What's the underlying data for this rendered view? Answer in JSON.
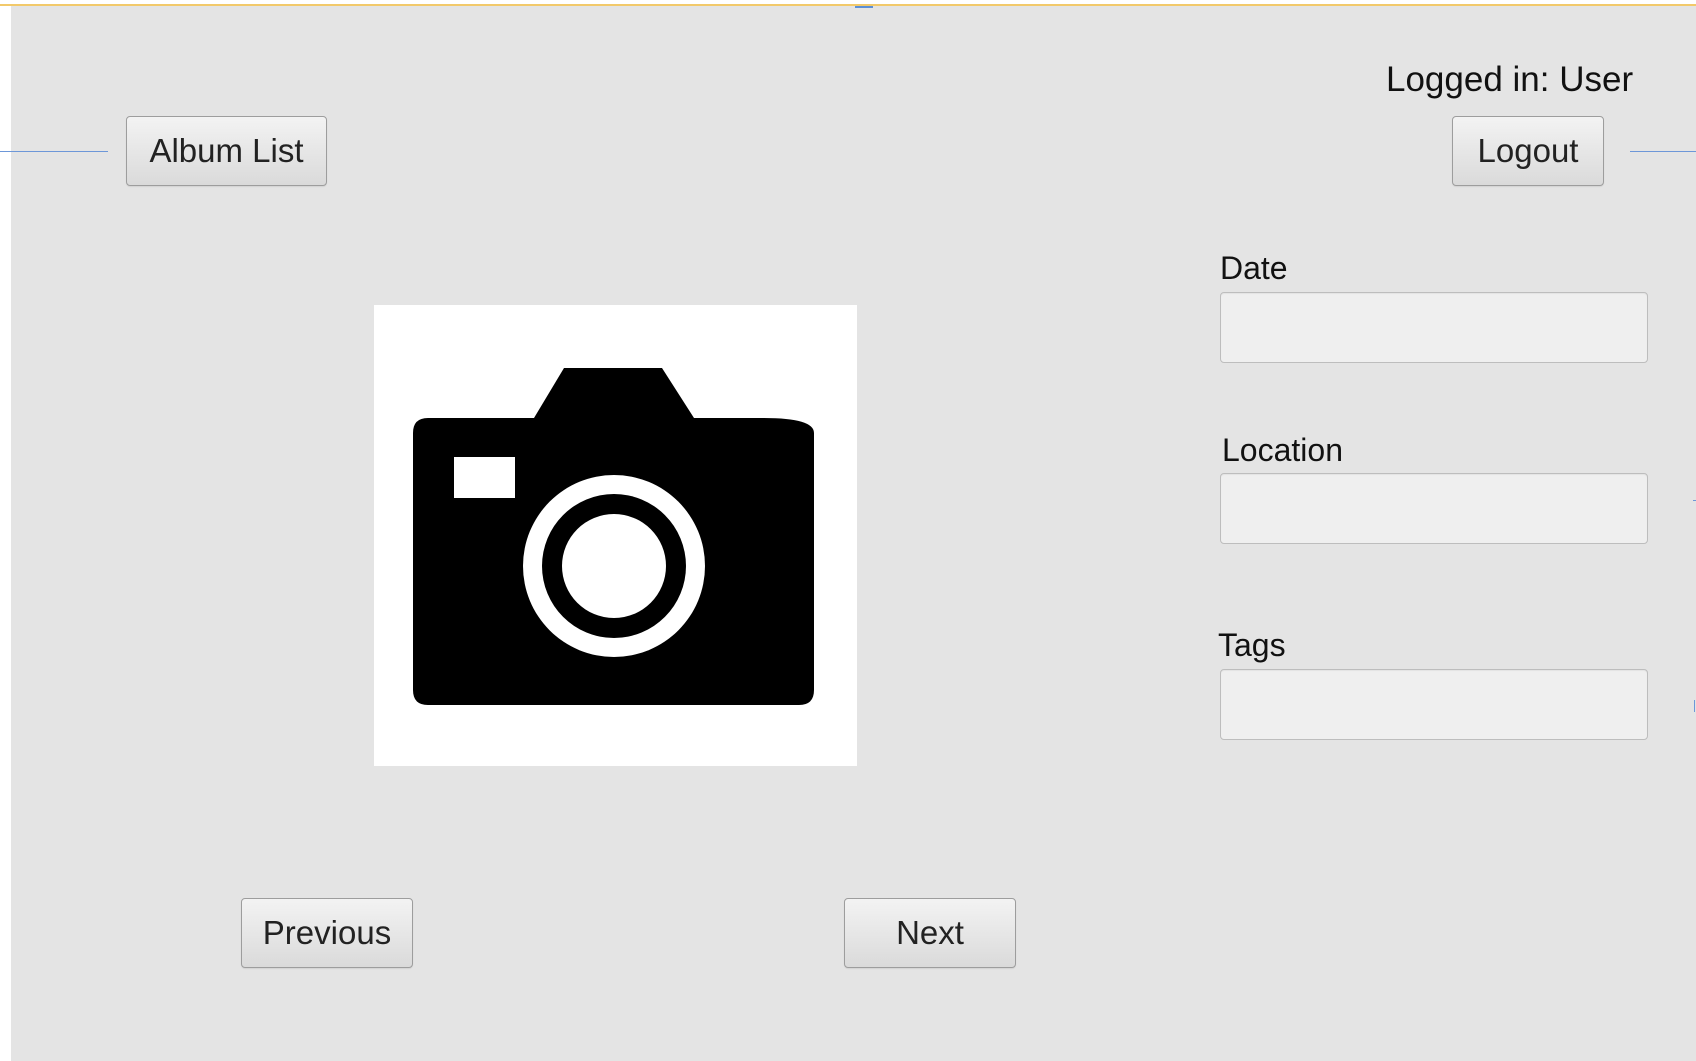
{
  "header": {
    "logged_in_text": "Logged in: User",
    "album_list_label": "Album List",
    "logout_label": "Logout"
  },
  "photo": {
    "icon": "camera-icon"
  },
  "details": {
    "date_label": "Date",
    "date_value": "",
    "location_label": "Location",
    "location_value": "",
    "tags_label": "Tags",
    "tags_value": ""
  },
  "navigation": {
    "previous_label": "Previous",
    "next_label": "Next"
  },
  "colors": {
    "panel_background": "#e4e4e4",
    "guide_line": "#6d97d8",
    "top_border": "#f2c96a"
  }
}
